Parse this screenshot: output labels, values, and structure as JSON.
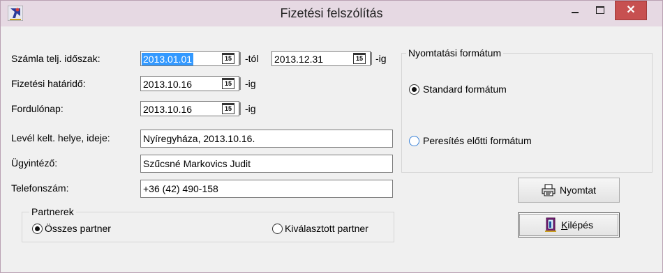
{
  "window": {
    "title": "Fizetési felszólítás",
    "close_glyph": "✕"
  },
  "form": {
    "period_label": "Számla telj. időszak:",
    "period_from": "2013.01.01",
    "from_suffix": "-tól",
    "period_to": "2013.12.31",
    "to_suffix": "-ig",
    "deadline_label": "Fizetési határidő:",
    "deadline": "2013.10.16",
    "deadline_suffix": "-ig",
    "turnover_label": "Fordulónap:",
    "turnover": "2013.10.16",
    "turnover_suffix": "-ig",
    "calendar_glyph": "15",
    "letter_label": "Levél kelt. helye, ideje:",
    "letter_value": "Nyíregyháza, 2013.10.16.",
    "clerk_label": "Ügyintéző:",
    "clerk_value": "Szűcsné Markovics Judit",
    "phone_label": "Telefonszám:",
    "phone_value": "+36 (42) 490-158"
  },
  "print_format": {
    "title": "Nyomtatási formátum",
    "options": [
      "Standard formátum",
      "Peresítés előtti formátum"
    ],
    "selected": "Standard formátum"
  },
  "partners": {
    "title": "Partnerek",
    "options": [
      "Összes partner",
      "Kiválasztott partner"
    ],
    "selected": "Összes partner"
  },
  "buttons": {
    "print": {
      "label": "Nyomtat",
      "icon": "printer-icon"
    },
    "exit": {
      "accel": "K",
      "rest": "ilépés",
      "icon": "exit-door-icon"
    }
  },
  "colors": {
    "accent": "#3399ff",
    "close": "#c75050",
    "titlebar": "#e6d9e3"
  }
}
